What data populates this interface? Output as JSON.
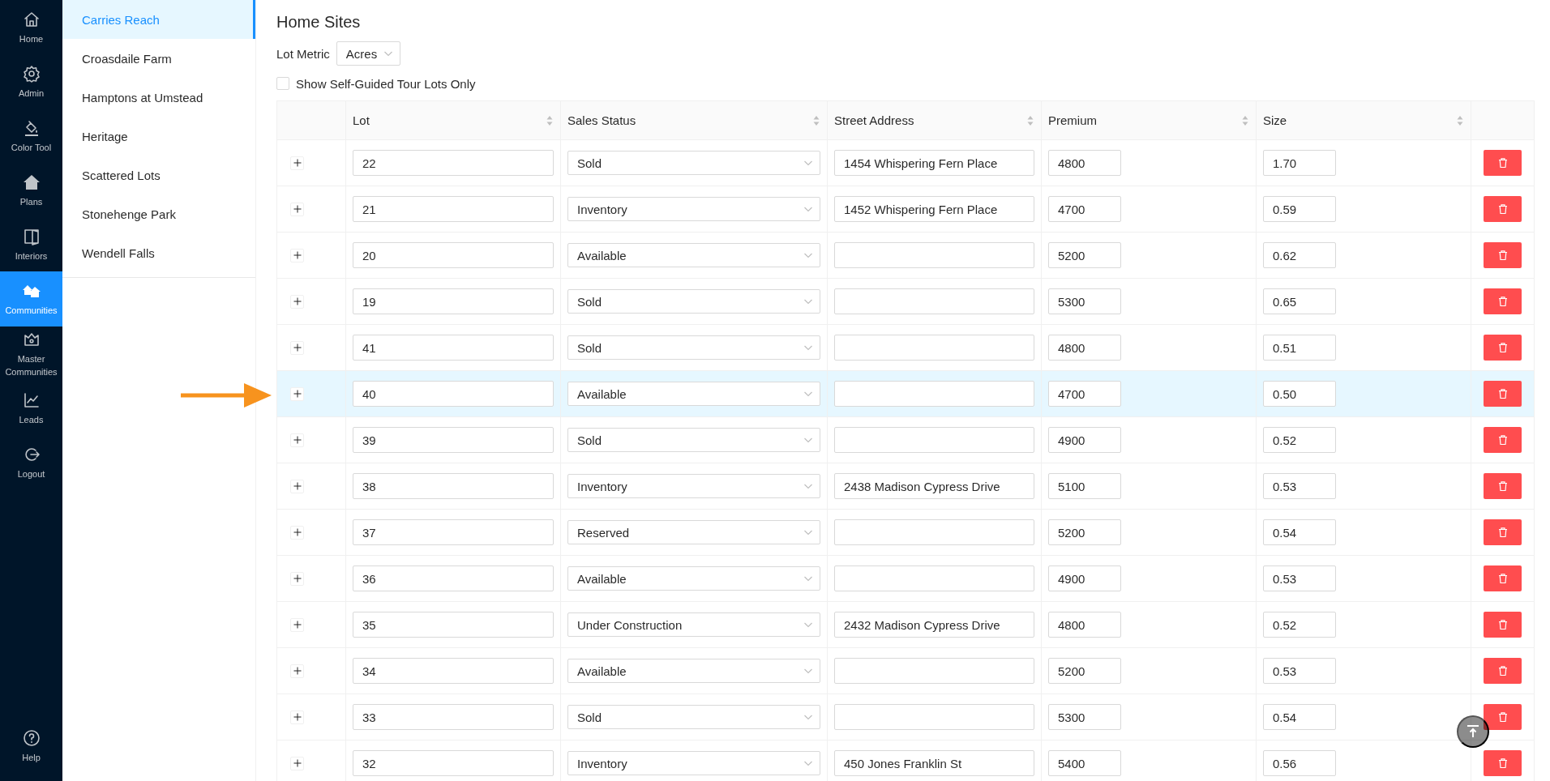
{
  "nav": {
    "items": [
      {
        "kind": "home",
        "label": "Home",
        "selected": false
      },
      {
        "kind": "admin",
        "label": "Admin",
        "selected": false
      },
      {
        "kind": "color",
        "label": "Color Tool",
        "selected": false
      },
      {
        "kind": "plans",
        "label": "Plans",
        "selected": false
      },
      {
        "kind": "interiors",
        "label": "Interiors",
        "selected": false
      },
      {
        "kind": "communities",
        "label": "Communities",
        "selected": true
      },
      {
        "kind": "master",
        "label": "Master Communities",
        "selected": false
      },
      {
        "kind": "leads",
        "label": "Leads",
        "selected": false
      },
      {
        "kind": "logout",
        "label": "Logout",
        "selected": false
      }
    ],
    "help": {
      "label": "Help"
    }
  },
  "communities": [
    {
      "name": "Carries Reach",
      "selected": true
    },
    {
      "name": "Croasdaile Farm",
      "selected": false
    },
    {
      "name": "Hamptons at Umstead",
      "selected": false
    },
    {
      "name": "Heritage",
      "selected": false
    },
    {
      "name": "Scattered Lots",
      "selected": false
    },
    {
      "name": "Stonehenge Park",
      "selected": false
    },
    {
      "name": "Wendell Falls",
      "selected": false
    }
  ],
  "page": {
    "title": "Home Sites",
    "lot_metric": {
      "label": "Lot Metric",
      "value": "Acres"
    },
    "self_guided_filter": {
      "label": "Show Self-Guided Tour Lots Only",
      "checked": false
    }
  },
  "table": {
    "columns": [
      "Lot",
      "Sales Status",
      "Street Address",
      "Premium",
      "Size"
    ],
    "rows": [
      {
        "lot": "22",
        "status": "Sold",
        "address": "1454 Whispering Fern Place",
        "premium": "4800",
        "size": "1.70",
        "selected": false
      },
      {
        "lot": "21",
        "status": "Inventory",
        "address": "1452 Whispering Fern Place",
        "premium": "4700",
        "size": "0.59",
        "selected": false
      },
      {
        "lot": "20",
        "status": "Available",
        "premium": "5200",
        "size": "0.62",
        "selected": false
      },
      {
        "lot": "19",
        "status": "Sold",
        "premium": "5300",
        "size": "0.65",
        "selected": false
      },
      {
        "lot": "41",
        "status": "Sold",
        "premium": "4800",
        "size": "0.51",
        "selected": false
      },
      {
        "lot": "40",
        "status": "Available",
        "premium": "4700",
        "size": "0.50",
        "selected": true
      },
      {
        "lot": "39",
        "status": "Sold",
        "premium": "4900",
        "size": "0.52",
        "selected": false
      },
      {
        "lot": "38",
        "status": "Inventory",
        "address": "2438 Madison Cypress Drive",
        "premium": "5100",
        "size": "0.53",
        "selected": false
      },
      {
        "lot": "37",
        "status": "Reserved",
        "premium": "5200",
        "size": "0.54",
        "selected": false
      },
      {
        "lot": "36",
        "status": "Available",
        "premium": "4900",
        "size": "0.53",
        "selected": false
      },
      {
        "lot": "35",
        "status": "Under Construction",
        "address": "2432 Madison Cypress Drive",
        "premium": "4800",
        "size": "0.52",
        "selected": false
      },
      {
        "lot": "34",
        "status": "Available",
        "premium": "5200",
        "size": "0.53",
        "selected": false
      },
      {
        "lot": "33",
        "status": "Sold",
        "premium": "5300",
        "size": "0.54",
        "selected": false
      },
      {
        "lot": "32",
        "status": "Inventory",
        "address": "450 Jones Franklin St",
        "premium": "5400",
        "size": "0.56",
        "selected": false
      }
    ]
  }
}
